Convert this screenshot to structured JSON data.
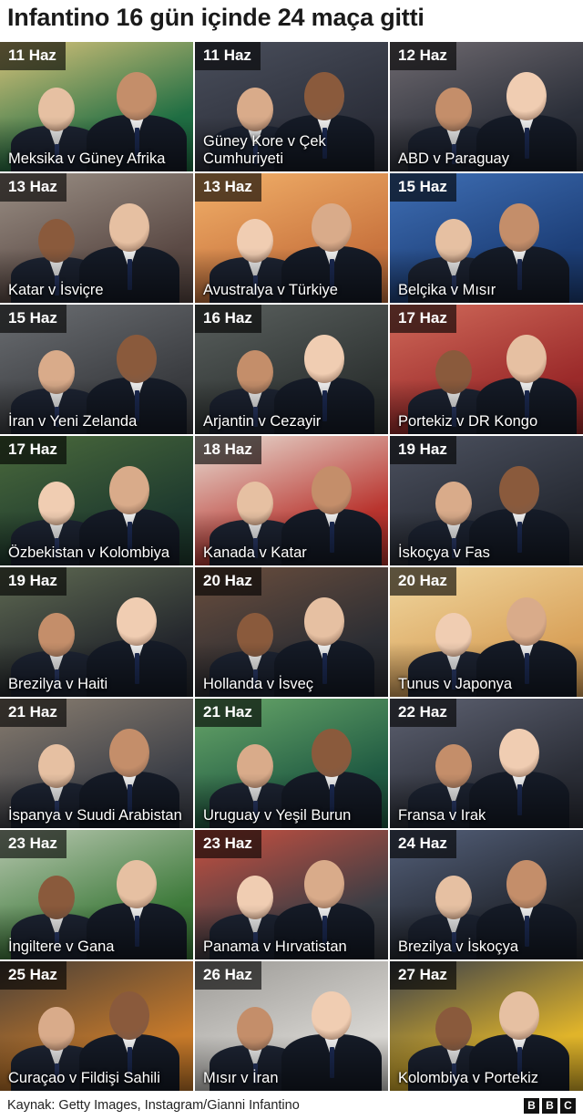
{
  "title": "Infantino 16 gün içinde 24 maça gitti",
  "tiles": [
    {
      "date": "11 Haz",
      "match": "Meksika v Güney Afrika",
      "bg": [
        "#1f6e43",
        "#d8c27a"
      ]
    },
    {
      "date": "11 Haz",
      "match": "Güney Kore v Çek Cumhuriyeti",
      "bg": [
        "#2c2f3a",
        "#4a4f5c"
      ]
    },
    {
      "date": "12 Haz",
      "match": "ABD v Paraguay",
      "bg": [
        "#2a2e38",
        "#6f6a70"
      ]
    },
    {
      "date": "13 Haz",
      "match": "Katar v İsviçre",
      "bg": [
        "#5b4a45",
        "#9a8f85"
      ]
    },
    {
      "date": "13 Haz",
      "match": "Avustralya v Türkiye",
      "bg": [
        "#c9743e",
        "#f2b16a"
      ]
    },
    {
      "date": "15 Haz",
      "match": "Belçika v Mısır",
      "bg": [
        "#1d3f78",
        "#3f6fb5"
      ]
    },
    {
      "date": "15 Haz",
      "match": "İran v Yeni Zelanda",
      "bg": [
        "#3a3c40",
        "#6b6e72"
      ]
    },
    {
      "date": "16 Haz",
      "match": "Arjantin v Cezayir",
      "bg": [
        "#2f3433",
        "#5a605e"
      ]
    },
    {
      "date": "17 Haz",
      "match": "Portekiz v DR Kongo",
      "bg": [
        "#9b2a2a",
        "#d06a5a"
      ]
    },
    {
      "date": "17 Haz",
      "match": "Özbekistan v Kolombiya",
      "bg": [
        "#1e3a2e",
        "#4b6a3c"
      ]
    },
    {
      "date": "18 Haz",
      "match": "Kanada v Katar",
      "bg": [
        "#b9342e",
        "#e8e0d6"
      ]
    },
    {
      "date": "19 Haz",
      "match": "İskoçya v Fas",
      "bg": [
        "#262a33",
        "#4d5260"
      ]
    },
    {
      "date": "19 Haz",
      "match": "Brezilya v Haiti",
      "bg": [
        "#23262c",
        "#5f6a52"
      ]
    },
    {
      "date": "20 Haz",
      "match": "Hollanda v İsveç",
      "bg": [
        "#2b2d33",
        "#6b4e3d"
      ]
    },
    {
      "date": "20 Haz",
      "match": "Tunus v Japonya",
      "bg": [
        "#d9a25a",
        "#f0d7a0"
      ]
    },
    {
      "date": "21 Haz",
      "match": "İspanya v Suudi Arabistan",
      "bg": [
        "#3c3f47",
        "#8a7e70"
      ]
    },
    {
      "date": "21 Haz",
      "match": "Uruguay v Yeşil Burun",
      "bg": [
        "#1f5a42",
        "#6aa86a"
      ]
    },
    {
      "date": "22 Haz",
      "match": "Fransa v Irak",
      "bg": [
        "#2a2d36",
        "#5e6272"
      ]
    },
    {
      "date": "23 Haz",
      "match": "İngiltere v Gana",
      "bg": [
        "#3d7a3a",
        "#b8c7b0"
      ]
    },
    {
      "date": "23 Haz",
      "match": "Panama v Hırvatistan",
      "bg": [
        "#3a3d44",
        "#c95040"
      ]
    },
    {
      "date": "24 Haz",
      "match": "Brezilya v İskoçya",
      "bg": [
        "#22262e",
        "#54607a"
      ]
    },
    {
      "date": "25 Haz",
      "match": "Curaçao v Fildişi Sahili",
      "bg": [
        "#c77a2a",
        "#4a4038"
      ]
    },
    {
      "date": "26 Haz",
      "match": "Mısır v İran",
      "bg": [
        "#d8d6d2",
        "#9c9a96"
      ]
    },
    {
      "date": "27 Haz",
      "match": "Kolombiya v Portekiz",
      "bg": [
        "#e0b42a",
        "#3a3f4a"
      ]
    }
  ],
  "footer": {
    "source": "Kaynak: Getty Images, Instagram/Gianni Infantino",
    "logo": [
      "B",
      "B",
      "C"
    ]
  }
}
